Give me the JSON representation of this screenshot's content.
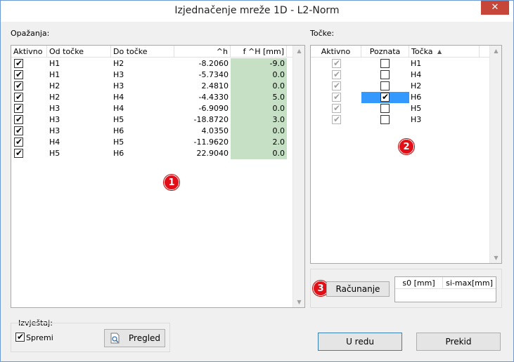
{
  "window": {
    "title": "Izjednačenje mreže 1D - L2-Norm",
    "close_glyph": "✕"
  },
  "observations": {
    "label": "Opažanja:",
    "headers": [
      "Aktivno",
      "Od točke",
      "Do točke",
      "^h",
      "f ^H [mm]"
    ],
    "rows": [
      {
        "active": true,
        "from": "H1",
        "to": "H2",
        "dh": "-8.2060",
        "f": "-9.0"
      },
      {
        "active": true,
        "from": "H1",
        "to": "H3",
        "dh": "-5.7340",
        "f": "0.0"
      },
      {
        "active": true,
        "from": "H2",
        "to": "H3",
        "dh": "2.4810",
        "f": "0.0"
      },
      {
        "active": true,
        "from": "H2",
        "to": "H4",
        "dh": "-4.4330",
        "f": "5.0"
      },
      {
        "active": true,
        "from": "H3",
        "to": "H4",
        "dh": "-6.9090",
        "f": "0.0"
      },
      {
        "active": true,
        "from": "H3",
        "to": "H5",
        "dh": "-18.8720",
        "f": "3.0"
      },
      {
        "active": true,
        "from": "H3",
        "to": "H6",
        "dh": "4.0350",
        "f": "0.0"
      },
      {
        "active": true,
        "from": "H4",
        "to": "H5",
        "dh": "-11.9620",
        "f": "2.0"
      },
      {
        "active": true,
        "from": "H5",
        "to": "H6",
        "dh": "22.9040",
        "f": "0.0"
      }
    ]
  },
  "points": {
    "label": "Točke:",
    "headers": [
      "Aktivno",
      "Poznata",
      "Točka"
    ],
    "sort_glyph": "▲",
    "rows": [
      {
        "active": true,
        "known": false,
        "name": "H1"
      },
      {
        "active": true,
        "known": false,
        "name": "H4"
      },
      {
        "active": true,
        "known": false,
        "name": "H2"
      },
      {
        "active": true,
        "known": true,
        "name": "H6",
        "selected": true
      },
      {
        "active": true,
        "known": false,
        "name": "H5"
      },
      {
        "active": true,
        "known": false,
        "name": "H3"
      }
    ]
  },
  "compute": {
    "button_label": "Računanje",
    "result_headers": [
      "s0 [mm]",
      "si-max[mm]"
    ]
  },
  "report": {
    "label": "Izvještaj:",
    "save_label": "Spremi",
    "save_checked": true,
    "preview_label": "Pregled"
  },
  "footer": {
    "ok_label": "U redu",
    "cancel_label": "Prekid"
  },
  "markers": [
    "1",
    "2",
    "3"
  ],
  "icons": {
    "check": "✔",
    "scroll_up": "▲",
    "scroll_down": "▼",
    "preview": "document-preview-icon"
  },
  "colors": {
    "green_cell": "#c6e0c5",
    "selection": "#3399ff",
    "marker": "#e20f18"
  }
}
